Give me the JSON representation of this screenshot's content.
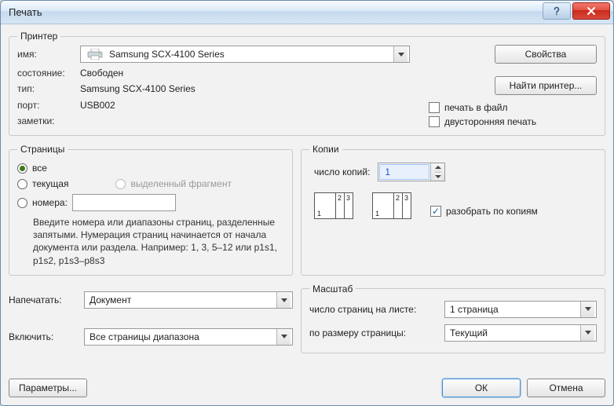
{
  "title": "Печать",
  "printer": {
    "legend": "Принтер",
    "name_label": "имя:",
    "name_value": "Samsung SCX-4100 Series",
    "status_label": "состояние:",
    "status_value": "Свободен",
    "type_label": "тип:",
    "type_value": "Samsung SCX-4100 Series",
    "port_label": "порт:",
    "port_value": "USB002",
    "notes_label": "заметки:",
    "notes_value": "",
    "properties_btn": "Свойства",
    "find_btn": "Найти принтер...",
    "to_file_label": "печать в файл",
    "duplex_label": "двусторонняя печать"
  },
  "pages": {
    "legend": "Страницы",
    "all": "все",
    "current": "текущая",
    "selection": "выделенный фрагмент",
    "numbers": "номера:",
    "hint": "Введите номера или диапазоны страниц, разделенные запятыми. Нумерация страниц начинается от начала документа или раздела. Например: 1, 3, 5–12 или p1s1, p1s2, p1s3–p8s3"
  },
  "copies": {
    "legend": "Копии",
    "count_label": "число копий:",
    "count_value": "1",
    "collate_label": "разобрать по копиям"
  },
  "print_what": {
    "print_label": "Напечатать:",
    "print_value": "Документ",
    "include_label": "Включить:",
    "include_value": "Все страницы диапазона"
  },
  "scale": {
    "legend": "Масштаб",
    "per_sheet_label": "число страниц на листе:",
    "per_sheet_value": "1 страница",
    "fit_label": "по размеру страницы:",
    "fit_value": "Текущий"
  },
  "footer": {
    "params": "Параметры...",
    "ok": "ОК",
    "cancel": "Отмена"
  }
}
